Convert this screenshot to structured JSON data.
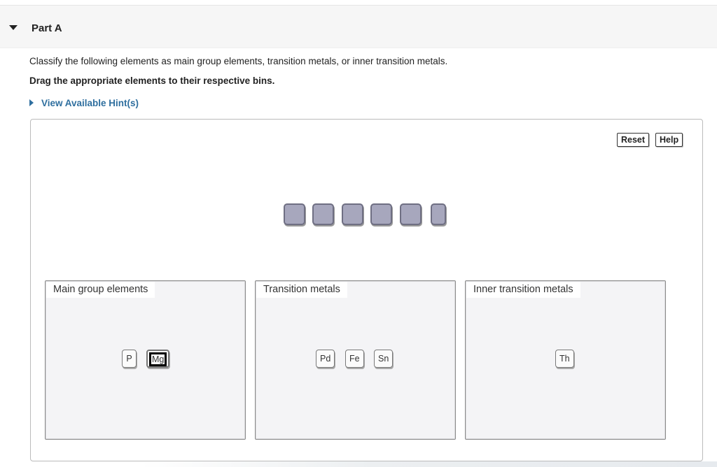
{
  "part": {
    "title": "Part A"
  },
  "question": {
    "prompt": "Classify the following elements as main group elements, transition metals, or inner transition metals.",
    "instruction": "Drag the appropriate elements to their respective bins.",
    "hint_link": "View Available Hint(s)"
  },
  "toolbar": {
    "reset_label": "Reset",
    "help_label": "Help"
  },
  "slots": {
    "empty_count": 6
  },
  "bins": [
    {
      "label": "Main group elements",
      "items": [
        "P",
        "Mg"
      ],
      "selected": "Mg"
    },
    {
      "label": "Transition metals",
      "items": [
        "Pd",
        "Fe",
        "Sn"
      ]
    },
    {
      "label": "Inner transition metals",
      "items": [
        "Th"
      ]
    }
  ],
  "colors": {
    "link": "#2f6f9f",
    "slot_fill": "#a7a7bd",
    "bin_fill": "#f4f4f6"
  },
  "icons": {
    "collapse": "caret-down-icon",
    "expand_hint": "caret-right-icon"
  }
}
